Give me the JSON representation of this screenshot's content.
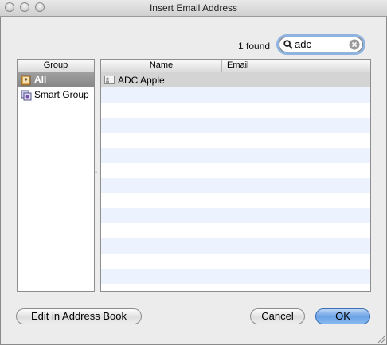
{
  "window": {
    "title": "Insert Email Address"
  },
  "search": {
    "found_text": "1 found",
    "value": "adc"
  },
  "groups": {
    "header": "Group",
    "items": [
      {
        "label": "All",
        "selected": true
      },
      {
        "label": "Smart Group",
        "selected": false
      }
    ]
  },
  "list": {
    "columns": [
      "Name",
      "Email"
    ],
    "rows": [
      {
        "name": "ADC Apple",
        "email": "",
        "selected": true
      }
    ]
  },
  "buttons": {
    "edit": "Edit in Address Book",
    "cancel": "Cancel",
    "ok": "OK"
  },
  "colors": {
    "default_button": "#6aa2e6",
    "focus_ring": "#8fb3e0",
    "row_stripe": "#edf3fe"
  }
}
